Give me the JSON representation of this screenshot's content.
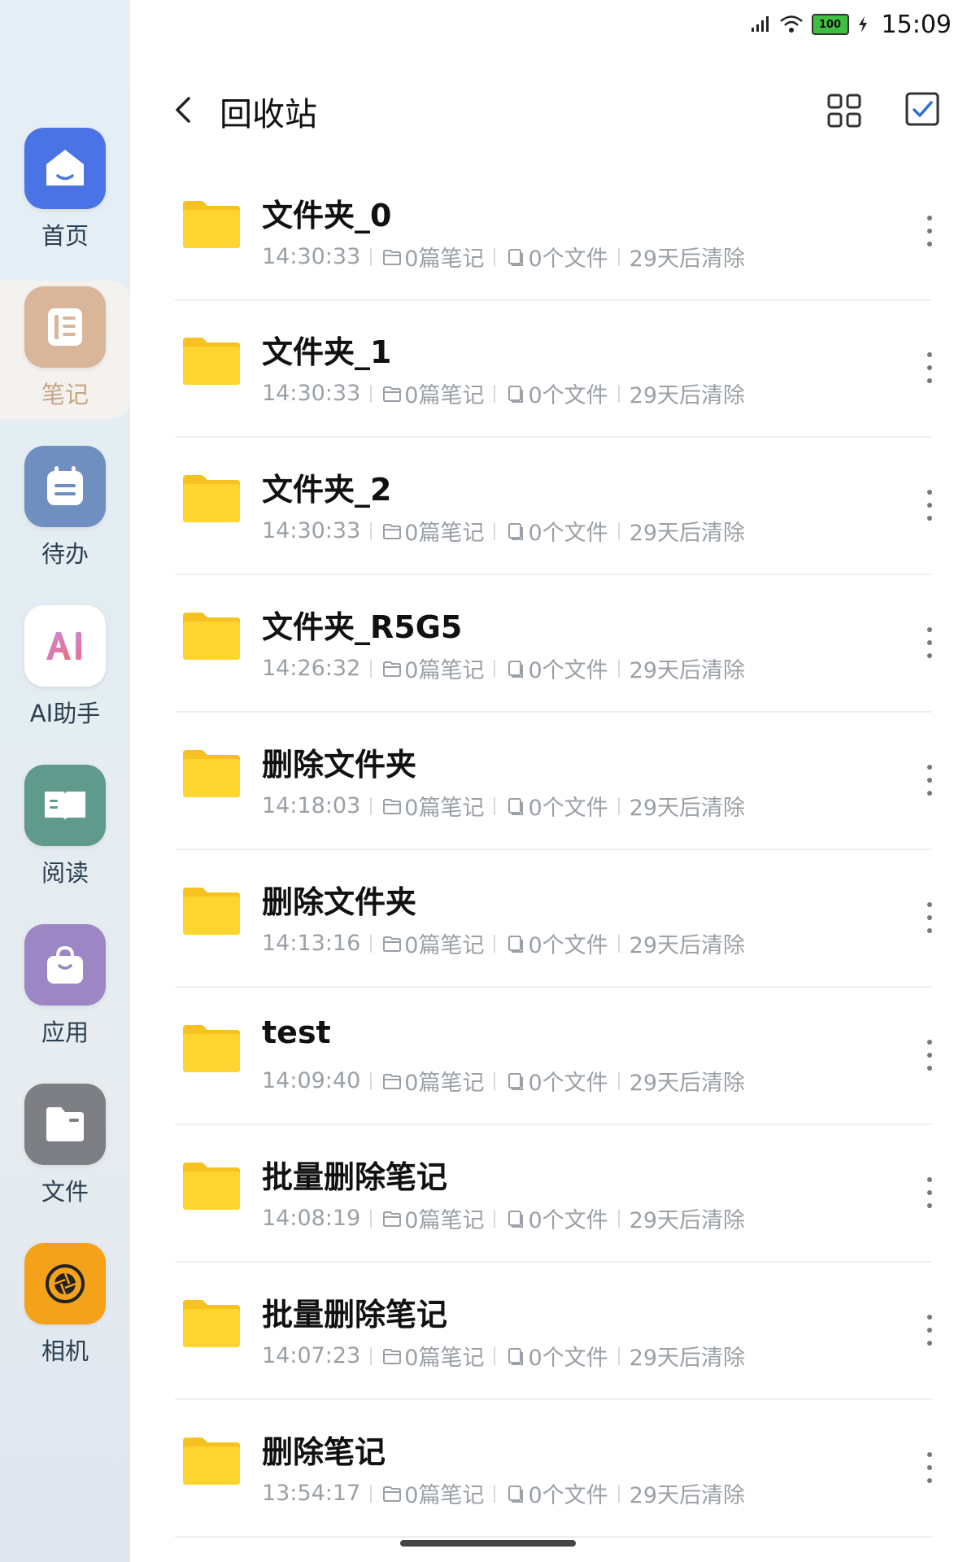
{
  "status_bar": {
    "battery": "100",
    "time": "15:09"
  },
  "header": {
    "title": "回收站"
  },
  "sidebar": {
    "items": [
      {
        "label": "首页",
        "icon": "home-icon",
        "color": "#4a74e6"
      },
      {
        "label": "笔记",
        "icon": "notes-icon",
        "color": "#d9b69a"
      },
      {
        "label": "待办",
        "icon": "todo-icon",
        "color": "#6f8fc0"
      },
      {
        "label": "AI助手",
        "icon": "ai-icon",
        "color": "#ffffff"
      },
      {
        "label": "阅读",
        "icon": "reading-icon",
        "color": "#5f9a8c"
      },
      {
        "label": "应用",
        "icon": "apps-icon",
        "color": "#9c86c4"
      },
      {
        "label": "文件",
        "icon": "files-icon",
        "color": "#7d7f84"
      },
      {
        "label": "相机",
        "icon": "camera-icon",
        "color": "#f5a21b"
      }
    ],
    "active_index": 1
  },
  "folders": [
    {
      "name": "文件夹_0",
      "time": "14:30:33",
      "notes": "0篇笔记",
      "files": "0个文件",
      "clear": "29天后清除"
    },
    {
      "name": "文件夹_1",
      "time": "14:30:33",
      "notes": "0篇笔记",
      "files": "0个文件",
      "clear": "29天后清除"
    },
    {
      "name": "文件夹_2",
      "time": "14:30:33",
      "notes": "0篇笔记",
      "files": "0个文件",
      "clear": "29天后清除"
    },
    {
      "name": "文件夹_R5G5",
      "time": "14:26:32",
      "notes": "0篇笔记",
      "files": "0个文件",
      "clear": "29天后清除"
    },
    {
      "name": "删除文件夹",
      "time": "14:18:03",
      "notes": "0篇笔记",
      "files": "0个文件",
      "clear": "29天后清除"
    },
    {
      "name": "删除文件夹",
      "time": "14:13:16",
      "notes": "0篇笔记",
      "files": "0个文件",
      "clear": "29天后清除"
    },
    {
      "name": "test",
      "time": "14:09:40",
      "notes": "0篇笔记",
      "files": "0个文件",
      "clear": "29天后清除"
    },
    {
      "name": "批量删除笔记",
      "time": "14:08:19",
      "notes": "0篇笔记",
      "files": "0个文件",
      "clear": "29天后清除"
    },
    {
      "name": "批量删除笔记",
      "time": "14:07:23",
      "notes": "0篇笔记",
      "files": "0个文件",
      "clear": "29天后清除"
    },
    {
      "name": "删除笔记",
      "time": "13:54:17",
      "notes": "0篇笔记",
      "files": "0个文件",
      "clear": "29天后清除"
    }
  ],
  "colors": {
    "folder": "#fdd430",
    "folder_tab": "#f7c21f",
    "accent": "#2f6fd6"
  }
}
